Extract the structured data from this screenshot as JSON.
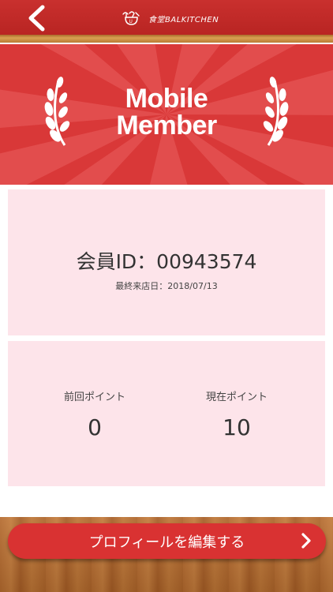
{
  "header": {
    "back_icon": "chevron-left-icon",
    "logo_text": "食堂BALKITCHEN"
  },
  "banner": {
    "title_line1": "Mobile",
    "title_line2": "Member",
    "laurel_icon": "laurel-icon"
  },
  "member": {
    "id_text": "会員ID：00943574",
    "last_visit": "最終来店日：2018/07/13"
  },
  "points": {
    "previous_label": "前回ポイント",
    "previous_value": "0",
    "current_label": "現在ポイント",
    "current_value": "10"
  },
  "footer": {
    "edit_profile_label": "プロフィールを編集する",
    "chevron_icon": "chevron-right-icon"
  },
  "colors": {
    "header_red": "#c9302e",
    "banner_red": "#d93838",
    "card_pink": "#fde4ea",
    "button_red": "#d93232"
  }
}
